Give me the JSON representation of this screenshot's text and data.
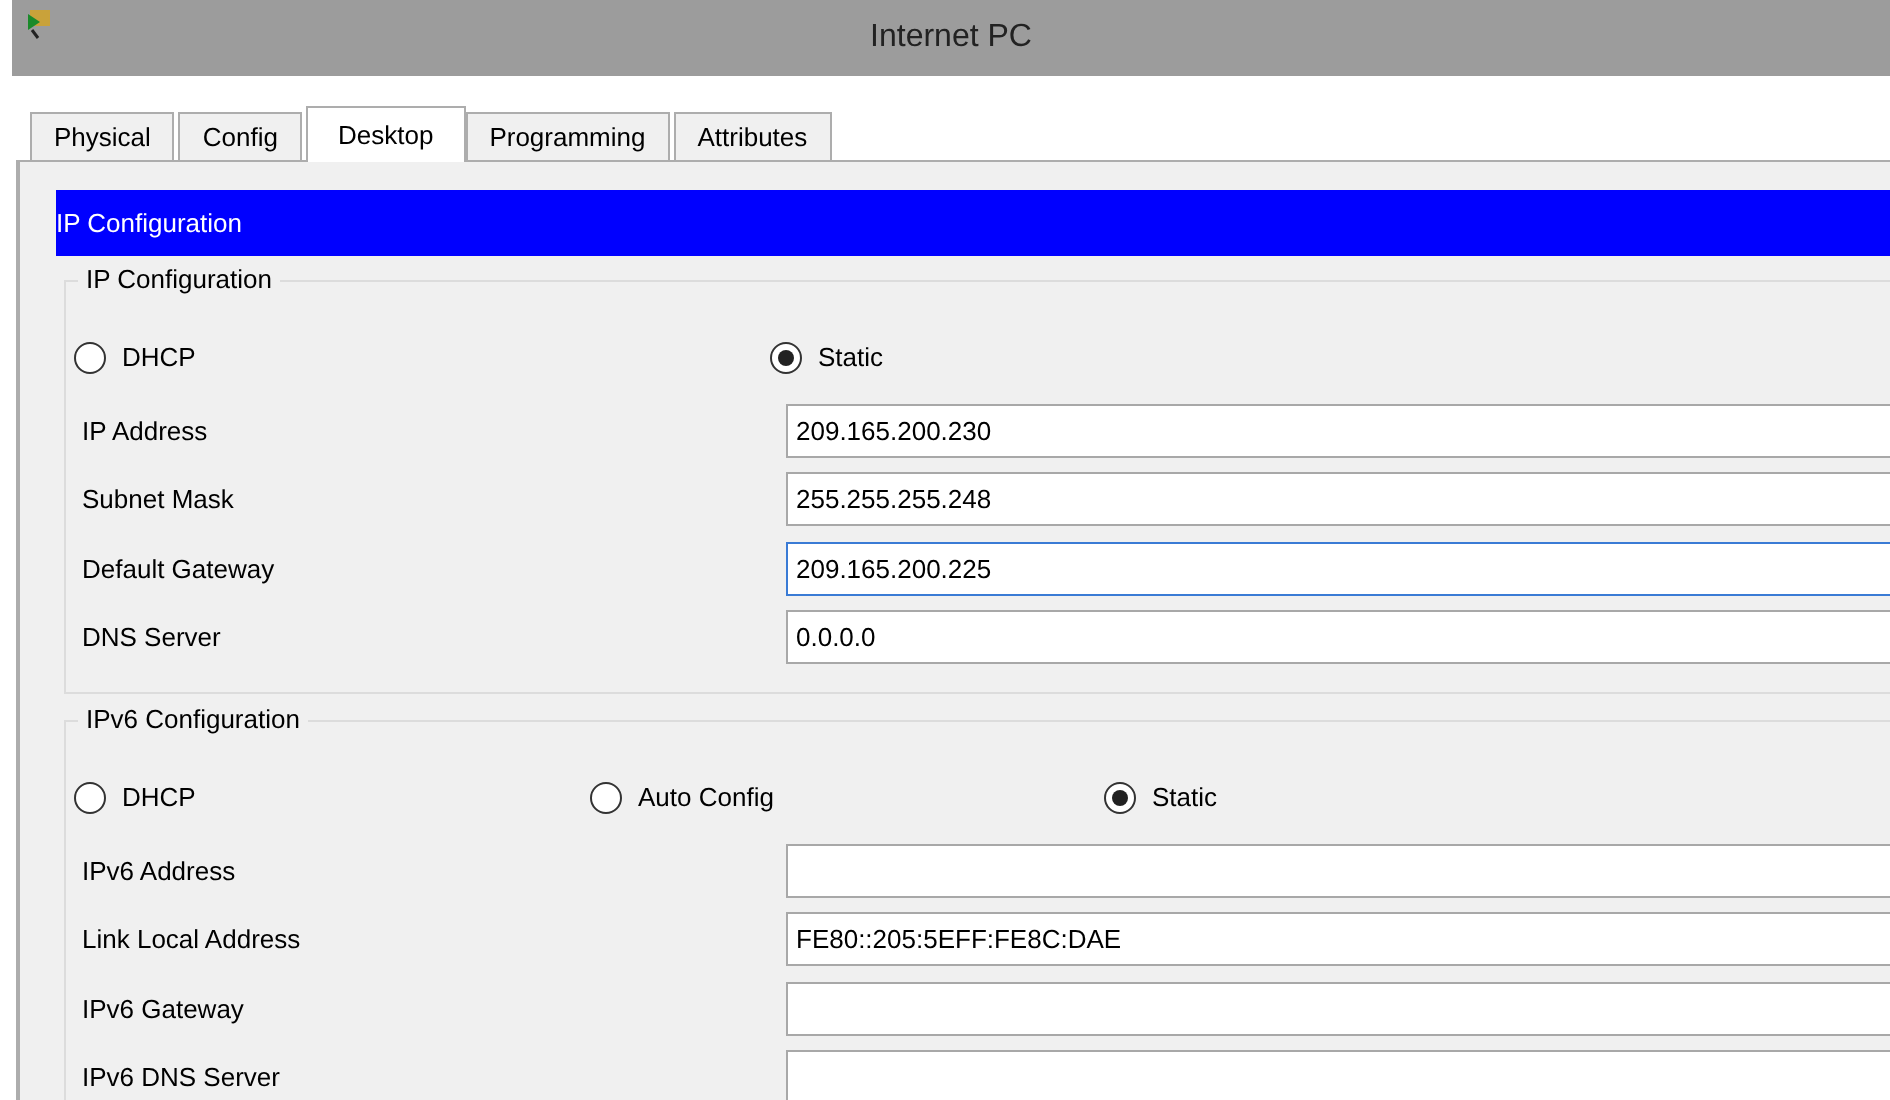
{
  "window": {
    "title": "Internet PC"
  },
  "tabs": [
    {
      "label": "Physical",
      "selected": false
    },
    {
      "label": "Config",
      "selected": false
    },
    {
      "label": "Desktop",
      "selected": true
    },
    {
      "label": "Programming",
      "selected": false
    },
    {
      "label": "Attributes",
      "selected": false
    }
  ],
  "header": "IP Configuration",
  "ipv4": {
    "title": "IP Configuration",
    "modes": [
      {
        "label": "DHCP",
        "selected": false
      },
      {
        "label": "Static",
        "selected": true
      }
    ],
    "fields": [
      {
        "label": "IP Address",
        "value": "209.165.200.230",
        "focused": false
      },
      {
        "label": "Subnet Mask",
        "value": "255.255.255.248",
        "focused": false
      },
      {
        "label": "Default Gateway",
        "value": "209.165.200.225",
        "focused": true
      },
      {
        "label": "DNS Server",
        "value": "0.0.0.0",
        "focused": false
      }
    ]
  },
  "ipv6": {
    "title": "IPv6 Configuration",
    "modes": [
      {
        "label": "DHCP",
        "selected": false
      },
      {
        "label": "Auto Config",
        "selected": false
      },
      {
        "label": "Static",
        "selected": true
      }
    ],
    "fields": [
      {
        "label": "IPv6 Address",
        "focused": false
      },
      {
        "label": "Link Local Address",
        "value": "FE80::205:5EFF:FE8C:DAE",
        "focused": false
      },
      {
        "label": "IPv6 Gateway",
        "focused": false
      },
      {
        "label": "IPv6 DNS Server",
        "focused": false
      }
    ]
  }
}
